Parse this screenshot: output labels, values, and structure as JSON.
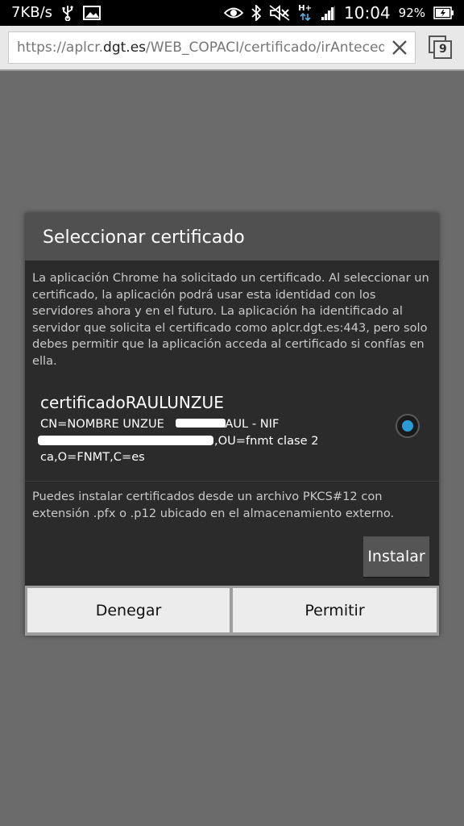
{
  "status_bar": {
    "speed": "7KB/s",
    "network_type": "H+",
    "time": "10:04",
    "battery": "92%",
    "icons": [
      "usb-icon",
      "image-icon",
      "eye-icon",
      "bluetooth-icon",
      "mute-icon",
      "data-arrows-icon",
      "signal-icon",
      "battery-icon"
    ]
  },
  "browser": {
    "url_scheme": "https://aplcr.",
    "url_host": "dgt.es",
    "url_path": "/WEB_COPACI/certificado/irAntecede",
    "tab_count": "9"
  },
  "dialog": {
    "title": "Seleccionar certificado",
    "description": "La aplicación Chrome ha solicitado un certificado. Al seleccionar un certificado, la aplicación podrá usar esta identidad con los servidores ahora y en el futuro. La aplicación ha identificado al servidor que solicita el certificado como aplcr.dgt.es:443, pero solo debes permitir que la aplicación acceda al certificado si confías en ella.",
    "certificate": {
      "name": "certificadoRAULUNZUE",
      "line1a": "CN=NOMBRE UNZUE",
      "line1b": "RAUL - NIF",
      "line2": ",OU=fnmt clase 2",
      "line3": "ca,O=FNMT,C=es",
      "selected": true
    },
    "install_text": "Puedes instalar certificados desde un archivo PKCS#12 con extensión .pfx o .p12 ubicado en el almacenamiento externo.",
    "install_label": "Instalar",
    "deny_label": "Denegar",
    "allow_label": "Permitir"
  },
  "colors": {
    "accent": "#2b9bd6",
    "dialog_bg": "#2b2b2b",
    "title_bg": "#505050",
    "page_bg": "#6b6b6b"
  }
}
